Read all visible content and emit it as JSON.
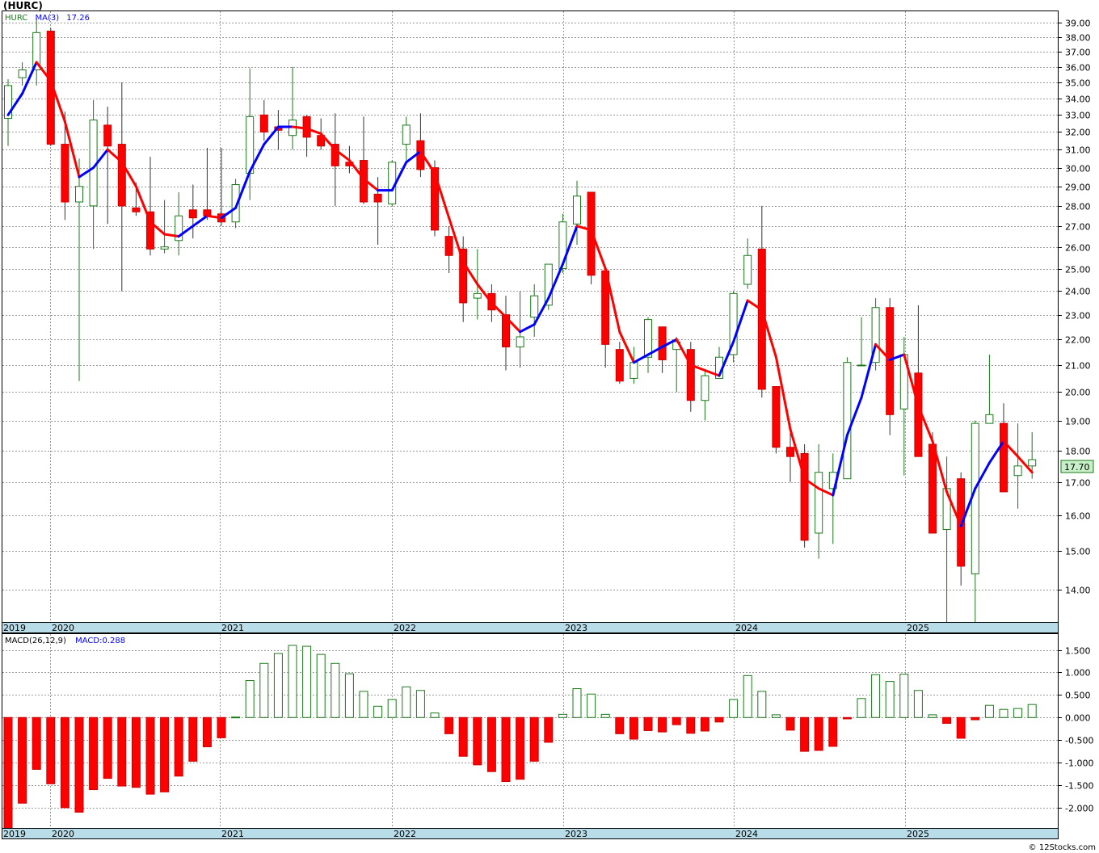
{
  "title": "(HURC)",
  "price_legend": {
    "symbol": "HURC",
    "ma_label": "MA(3)",
    "ma_value": "17.26"
  },
  "macd_legend": {
    "label": "MACD(26,12,9)",
    "value_label": "MACD:0.288"
  },
  "last_price_label": "17.70",
  "watermark": "© 12Stocks.com",
  "colors": {
    "up": "#1a7a1a",
    "down": "#ff0000",
    "ma_up": "#0000ff",
    "ma_down": "#ff0000",
    "axis_band": "#b8dce8",
    "last_label_bg": "#c8f0c8"
  },
  "year_labels": [
    "2019",
    "2020",
    "2021",
    "2022",
    "2023",
    "2024",
    "2025"
  ],
  "chart_data": [
    {
      "type": "candlestick",
      "scale": "log",
      "ylim": [
        13.2,
        39.8
      ],
      "y_ticks": [
        "14.00",
        "15.00",
        "16.00",
        "17.00",
        "18.00",
        "19.00",
        "20.00",
        "21.00",
        "22.00",
        "23.00",
        "24.00",
        "25.00",
        "26.00",
        "27.00",
        "28.00",
        "29.00",
        "30.00",
        "31.00",
        "32.00",
        "33.00",
        "34.00",
        "35.00",
        "36.00",
        "37.00",
        "38.00",
        "39.00"
      ],
      "candles": [
        {
          "o": 32.8,
          "h": 35.2,
          "l": 31.2,
          "c": 34.8
        },
        {
          "o": 35.3,
          "h": 36.3,
          "l": 34.8,
          "c": 35.8
        },
        {
          "o": 35.8,
          "h": 39.3,
          "l": 34.8,
          "c": 38.3
        },
        {
          "o": 38.4,
          "h": 38.6,
          "l": 31.2,
          "c": 31.3
        },
        {
          "o": 31.3,
          "h": 33.2,
          "l": 27.3,
          "c": 28.2
        },
        {
          "o": 28.2,
          "h": 30.5,
          "l": 20.4,
          "c": 29.0
        },
        {
          "o": 28.0,
          "h": 33.9,
          "l": 25.9,
          "c": 32.7
        },
        {
          "o": 32.4,
          "h": 33.5,
          "l": 27.1,
          "c": 31.2
        },
        {
          "o": 31.3,
          "h": 35.0,
          "l": 24.0,
          "c": 28.0
        },
        {
          "o": 27.9,
          "h": 29.2,
          "l": 27.5,
          "c": 27.7
        },
        {
          "o": 27.7,
          "h": 30.6,
          "l": 25.6,
          "c": 25.9
        },
        {
          "o": 25.9,
          "h": 28.3,
          "l": 25.7,
          "c": 26.0
        },
        {
          "o": 26.3,
          "h": 28.7,
          "l": 25.6,
          "c": 27.5
        },
        {
          "o": 27.8,
          "h": 29.1,
          "l": 26.4,
          "c": 27.4
        },
        {
          "o": 27.8,
          "h": 31.1,
          "l": 27.3,
          "c": 27.5
        },
        {
          "o": 27.6,
          "h": 31.1,
          "l": 27.0,
          "c": 27.2
        },
        {
          "o": 27.2,
          "h": 29.4,
          "l": 26.9,
          "c": 29.1
        },
        {
          "o": 29.7,
          "h": 35.9,
          "l": 28.3,
          "c": 32.9
        },
        {
          "o": 33.0,
          "h": 33.9,
          "l": 31.5,
          "c": 32.0
        },
        {
          "o": 32.3,
          "h": 33.3,
          "l": 31.0,
          "c": 32.1
        },
        {
          "o": 31.8,
          "h": 36.0,
          "l": 31.0,
          "c": 32.7
        },
        {
          "o": 32.9,
          "h": 33.0,
          "l": 30.6,
          "c": 31.7
        },
        {
          "o": 31.8,
          "h": 32.8,
          "l": 31.0,
          "c": 31.2
        },
        {
          "o": 31.3,
          "h": 33.1,
          "l": 28.0,
          "c": 30.1
        },
        {
          "o": 30.3,
          "h": 31.2,
          "l": 29.7,
          "c": 30.1
        },
        {
          "o": 30.4,
          "h": 32.9,
          "l": 28.1,
          "c": 28.2
        },
        {
          "o": 28.6,
          "h": 29.5,
          "l": 26.1,
          "c": 28.2
        },
        {
          "o": 28.1,
          "h": 30.4,
          "l": 28.0,
          "c": 30.3
        },
        {
          "o": 31.3,
          "h": 32.9,
          "l": 30.4,
          "c": 32.4
        },
        {
          "o": 31.5,
          "h": 33.1,
          "l": 29.5,
          "c": 29.9
        },
        {
          "o": 30.0,
          "h": 30.4,
          "l": 26.5,
          "c": 26.8
        },
        {
          "o": 26.5,
          "h": 27.0,
          "l": 24.8,
          "c": 25.6
        },
        {
          "o": 25.9,
          "h": 26.5,
          "l": 22.7,
          "c": 23.5
        },
        {
          "o": 23.7,
          "h": 25.9,
          "l": 22.8,
          "c": 23.9
        },
        {
          "o": 23.9,
          "h": 24.3,
          "l": 22.7,
          "c": 23.2
        },
        {
          "o": 23.0,
          "h": 23.8,
          "l": 20.8,
          "c": 21.7
        },
        {
          "o": 21.7,
          "h": 24.0,
          "l": 20.9,
          "c": 22.1
        },
        {
          "o": 22.9,
          "h": 24.3,
          "l": 22.1,
          "c": 23.8
        },
        {
          "o": 23.4,
          "h": 25.1,
          "l": 23.2,
          "c": 25.2
        },
        {
          "o": 25.0,
          "h": 27.6,
          "l": 24.8,
          "c": 27.2
        },
        {
          "o": 27.1,
          "h": 29.3,
          "l": 26.1,
          "c": 28.5
        },
        {
          "o": 28.7,
          "h": 28.7,
          "l": 24.3,
          "c": 24.7
        },
        {
          "o": 24.9,
          "h": 25.0,
          "l": 20.9,
          "c": 21.8
        },
        {
          "o": 21.6,
          "h": 21.9,
          "l": 20.3,
          "c": 20.4
        },
        {
          "o": 20.5,
          "h": 21.7,
          "l": 20.3,
          "c": 21.1
        },
        {
          "o": 21.3,
          "h": 22.9,
          "l": 20.7,
          "c": 22.8
        },
        {
          "o": 22.5,
          "h": 22.5,
          "l": 20.7,
          "c": 21.2
        },
        {
          "o": 21.6,
          "h": 22.1,
          "l": 20.0,
          "c": 21.9
        },
        {
          "o": 21.6,
          "h": 21.9,
          "l": 19.3,
          "c": 19.7
        },
        {
          "o": 19.7,
          "h": 20.8,
          "l": 19.0,
          "c": 20.6
        },
        {
          "o": 20.5,
          "h": 21.7,
          "l": 20.6,
          "c": 21.3
        },
        {
          "o": 21.4,
          "h": 24.0,
          "l": 21.1,
          "c": 23.9
        },
        {
          "o": 24.3,
          "h": 26.4,
          "l": 24.1,
          "c": 25.6
        },
        {
          "o": 25.9,
          "h": 28.0,
          "l": 19.8,
          "c": 20.1
        },
        {
          "o": 20.2,
          "h": 20.2,
          "l": 17.9,
          "c": 18.1
        },
        {
          "o": 18.1,
          "h": 18.9,
          "l": 17.0,
          "c": 17.8
        },
        {
          "o": 17.9,
          "h": 18.2,
          "l": 15.1,
          "c": 15.3
        },
        {
          "o": 15.5,
          "h": 18.2,
          "l": 14.8,
          "c": 17.3
        },
        {
          "o": 16.8,
          "h": 17.9,
          "l": 15.2,
          "c": 17.3
        },
        {
          "o": 17.1,
          "h": 21.3,
          "l": 17.1,
          "c": 21.1
        },
        {
          "o": 21.0,
          "h": 22.9,
          "l": 21.0,
          "c": 21.0
        },
        {
          "o": 21.1,
          "h": 23.7,
          "l": 20.8,
          "c": 23.3
        },
        {
          "o": 23.3,
          "h": 23.7,
          "l": 18.5,
          "c": 19.2
        },
        {
          "o": 19.4,
          "h": 22.1,
          "l": 17.2,
          "c": 21.4
        },
        {
          "o": 20.7,
          "h": 23.4,
          "l": 17.8,
          "c": 17.8
        },
        {
          "o": 18.2,
          "h": 18.6,
          "l": 15.5,
          "c": 15.5
        },
        {
          "o": 15.6,
          "h": 17.8,
          "l": 13.2,
          "c": 16.8
        },
        {
          "o": 17.1,
          "h": 17.3,
          "l": 14.1,
          "c": 14.6
        },
        {
          "o": 14.4,
          "h": 19.0,
          "l": 13.2,
          "c": 18.9
        },
        {
          "o": 18.9,
          "h": 21.4,
          "l": 18.9,
          "c": 19.2
        },
        {
          "o": 18.9,
          "h": 19.6,
          "l": 16.7,
          "c": 16.7
        },
        {
          "o": 17.2,
          "h": 18.9,
          "l": 16.2,
          "c": 17.5
        },
        {
          "o": 17.5,
          "h": 18.6,
          "l": 17.1,
          "c": 17.7
        }
      ],
      "ma3": [
        33.0,
        34.3,
        36.3,
        35.1,
        32.6,
        29.5,
        30.0,
        31.0,
        30.3,
        29.0,
        27.2,
        26.6,
        26.5,
        27.0,
        27.5,
        27.4,
        27.9,
        29.8,
        31.3,
        32.3,
        32.3,
        32.2,
        31.9,
        31.0,
        30.4,
        29.4,
        28.8,
        28.8,
        30.3,
        30.9,
        29.7,
        27.4,
        25.3,
        24.3,
        23.5,
        22.9,
        22.3,
        22.6,
        23.7,
        25.2,
        27.0,
        26.8,
        25.0,
        22.3,
        21.1,
        21.4,
        21.7,
        22.0,
        21.0,
        20.8,
        20.6,
        21.9,
        23.6,
        23.2,
        21.3,
        18.7,
        17.1,
        16.8,
        16.6,
        18.5,
        19.8,
        21.8,
        21.2,
        21.4,
        19.5,
        18.3,
        16.7,
        15.7,
        16.8,
        17.6,
        18.3,
        17.8,
        17.3
      ]
    },
    {
      "type": "bar",
      "title": "MACD(26,12,9)",
      "ylim": [
        -2.45,
        1.85
      ],
      "y_ticks": [
        "1.500",
        "1.000",
        "0.500",
        "0.000",
        "-0.500",
        "-1.000",
        "-1.500",
        "-2.000"
      ],
      "values": [
        -2.45,
        -1.9,
        -1.15,
        -1.47,
        -2.0,
        -2.1,
        -1.6,
        -1.35,
        -1.52,
        -1.55,
        -1.7,
        -1.65,
        -1.3,
        -0.97,
        -0.65,
        -0.45,
        0.01,
        0.82,
        1.2,
        1.42,
        1.6,
        1.58,
        1.4,
        1.2,
        0.97,
        0.58,
        0.25,
        0.4,
        0.68,
        0.6,
        0.1,
        -0.36,
        -0.86,
        -1.05,
        -1.2,
        -1.42,
        -1.37,
        -0.97,
        -0.55,
        0.07,
        0.64,
        0.52,
        0.07,
        -0.36,
        -0.48,
        -0.29,
        -0.32,
        -0.16,
        -0.35,
        -0.3,
        -0.1,
        0.4,
        0.93,
        0.58,
        0.06,
        -0.28,
        -0.75,
        -0.73,
        -0.64,
        -0.03,
        0.42,
        0.95,
        0.8,
        0.96,
        0.6,
        0.06,
        -0.13,
        -0.46,
        -0.05,
        0.27,
        0.18,
        0.2,
        0.288
      ]
    }
  ]
}
